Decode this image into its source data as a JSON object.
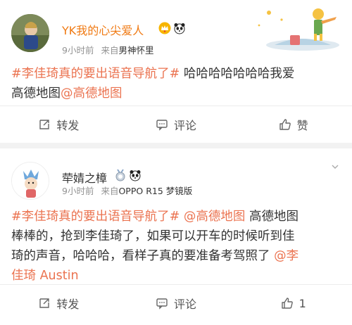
{
  "posts": [
    {
      "username": "YK我的心尖爱人",
      "time": "9小时前",
      "source_prefix": "来自",
      "source": "男神怀里",
      "text_topic": "#李佳琦真的要出语音导航了#",
      "text_body_1": " 哈哈哈哈哈哈哈我爱",
      "text_body_2": "高德地图",
      "text_mention": "@高德地图",
      "repost_label": "转发",
      "comment_label": "评论",
      "like_label": "赞"
    },
    {
      "username": "荦婧之樟",
      "time": "9小时前",
      "source_prefix": "来自",
      "source": "OPPO R15 梦镜版",
      "text_topic": "#李佳琦真的要出语音导航了#",
      "text_mention_1": " @高德地图",
      "text_body_1": " 高德地图",
      "text_body_2": "棒棒的，抢到李佳琦了，如果可以开车的时候听到佳",
      "text_body_3": "琦的声音，哈哈哈，看样子真的要准备考驾照了",
      "text_mention_2": " @李",
      "text_mention_3": "佳琦 Austin",
      "repost_label": "转发",
      "comment_label": "评论",
      "like_count": "1"
    }
  ],
  "colors": {
    "link": "#eb7350",
    "vip_name": "#f07a13",
    "meta": "#939393"
  }
}
